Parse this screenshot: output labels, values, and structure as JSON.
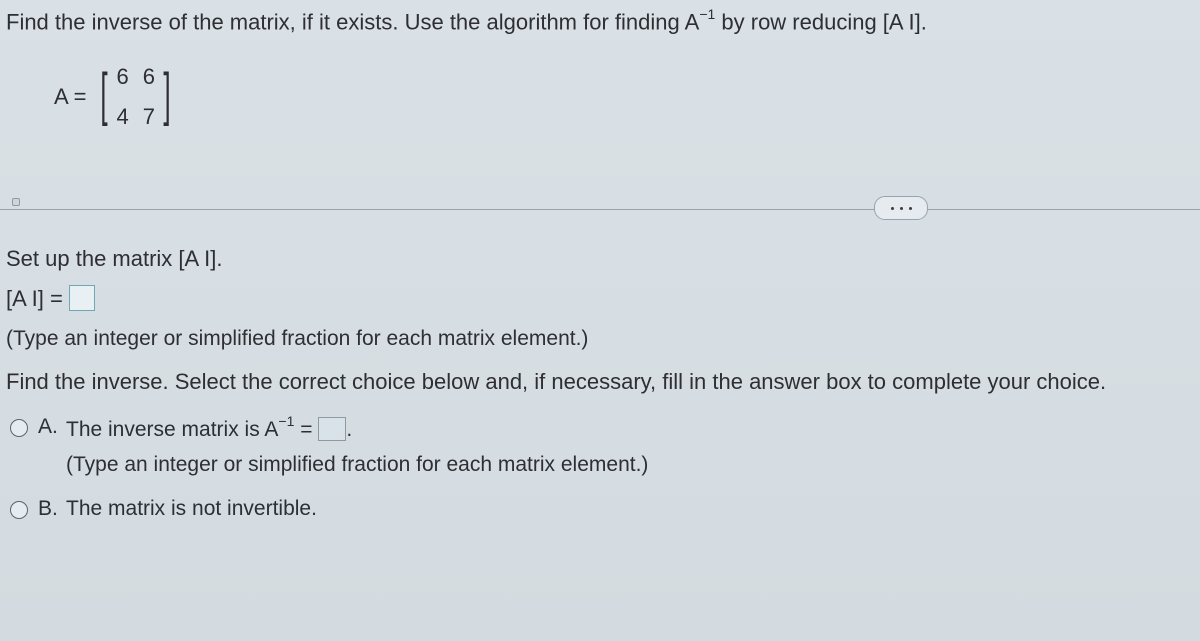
{
  "prompt": {
    "prefix": "Find the inverse of the matrix, if it exists. Use the algorithm for finding A",
    "exp": "−1",
    "suffix": " by row reducing [A  I]."
  },
  "matrix": {
    "lhs": "A =",
    "cells": {
      "r1c1": "6",
      "r1c2": "6",
      "r2c1": "4",
      "r2c2": "7"
    }
  },
  "step1": {
    "label": "Set up the matrix [A  I].",
    "expr_lhs": "[A  I] =",
    "hint": "(Type an integer or simplified fraction for each matrix element.)"
  },
  "step2": {
    "label": "Find the inverse. Select the correct choice below and, if necessary, fill in the answer box to complete your choice."
  },
  "choices": {
    "a": {
      "letter": "A.",
      "text_prefix": "The inverse matrix is A",
      "text_exp": "−1",
      "text_mid": " = ",
      "text_suffix": ".",
      "hint": "(Type an integer or simplified fraction for each matrix element.)"
    },
    "b": {
      "letter": "B.",
      "text": "The matrix is not invertible."
    }
  },
  "chart_data": {
    "type": "table",
    "description": "2x2 matrix A",
    "rows": [
      [
        6,
        6
      ],
      [
        4,
        7
      ]
    ]
  }
}
